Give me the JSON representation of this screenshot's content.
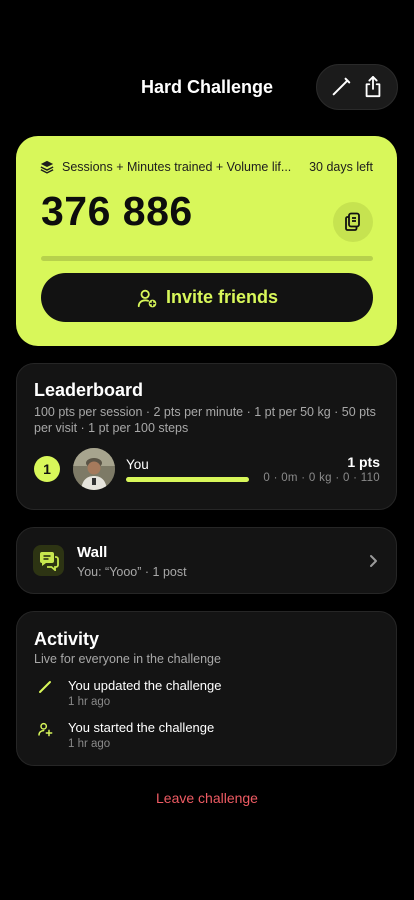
{
  "header": {
    "title": "Hard Challenge",
    "edit_icon": "pencil-icon",
    "share_icon": "share-icon"
  },
  "hero": {
    "metric_icon": "layers-icon",
    "metric": "Sessions + Minutes trained + Volume lif...",
    "days_left": "30 days left",
    "total": "376 886",
    "progress": 0.0,
    "copy_icon": "copy-icon",
    "invite_label": "Invite friends",
    "invite_icon": "add-user-icon"
  },
  "leaderboard": {
    "title": "Leaderboard",
    "description": "100 pts per session · 2 pts per minute · 1 pt per 50 kg · 50 pts per visit · 1 pt per 100 steps",
    "rows": [
      {
        "rank": "1",
        "name": "You",
        "points": "1 pts",
        "stats": "0 · 0m · 0 kg · 0 · 110",
        "progress": 1.0
      }
    ]
  },
  "wall": {
    "title": "Wall",
    "subtitle": "You: “Yooo” · 1 post",
    "icon": "chat-bubbles-icon"
  },
  "activity": {
    "title": "Activity",
    "subtitle": "Live for everyone in the challenge",
    "items": [
      {
        "icon": "pencil-icon",
        "text": "You updated the challenge",
        "time": "1 hr ago"
      },
      {
        "icon": "add-user-icon",
        "text": "You started the challenge",
        "time": "1 hr ago"
      }
    ]
  },
  "leave_label": "Leave challenge",
  "colors": {
    "accent": "#d8f75a",
    "danger": "#ee5b63",
    "background": "#000000",
    "card": "#141414"
  }
}
